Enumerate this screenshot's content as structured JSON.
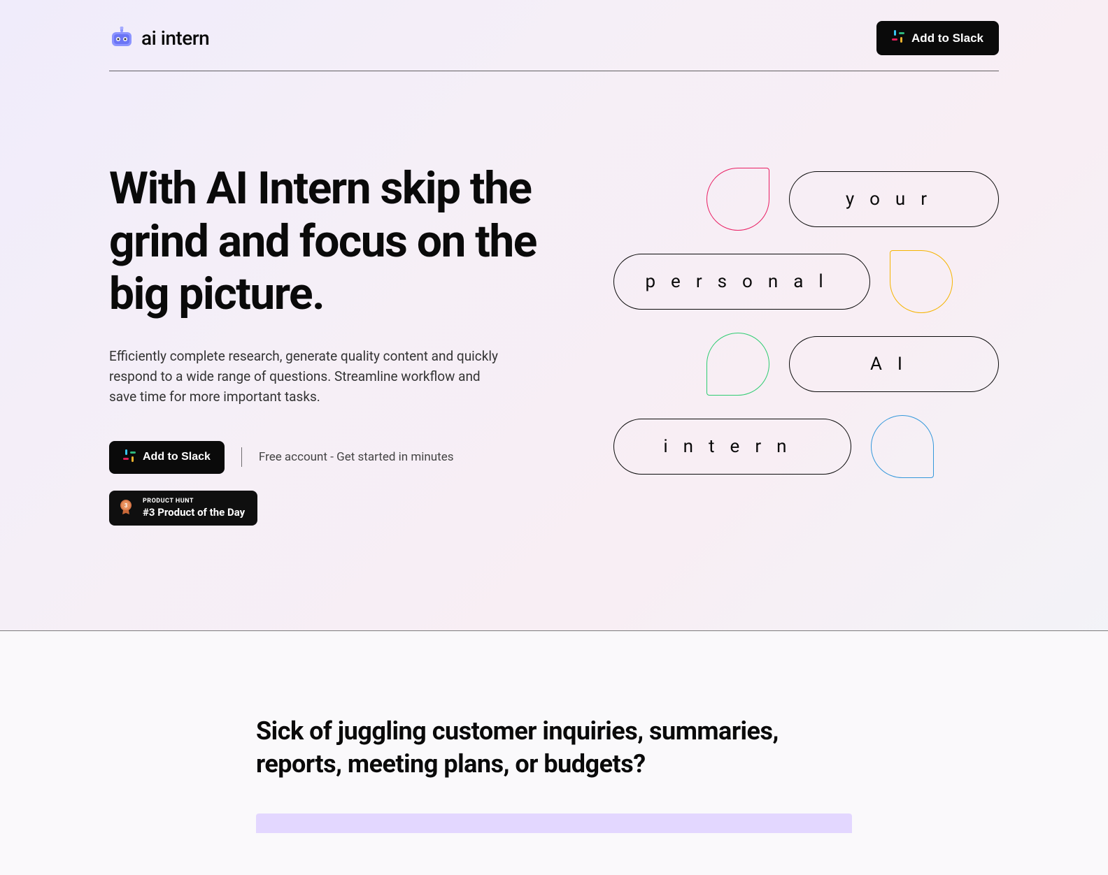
{
  "header": {
    "brand": "ai intern",
    "cta_label": "Add to Slack"
  },
  "hero": {
    "title": "With AI Intern skip the grind and focus on the big picture.",
    "description": "Efficiently complete research, generate quality content and quickly respond to a wide range of questions. Streamline workflow and save time for more important tasks.",
    "cta_label": "Add to Slack",
    "secondary_text": "Free account - Get started in minutes",
    "product_hunt": {
      "label": "PRODUCT HUNT",
      "title": "#3 Product of the Day"
    },
    "capsules": [
      "your",
      "personal",
      "AI",
      "intern"
    ]
  },
  "section2": {
    "title": "Sick of juggling customer inquiries, summaries, reports, meeting plans, or budgets?"
  }
}
